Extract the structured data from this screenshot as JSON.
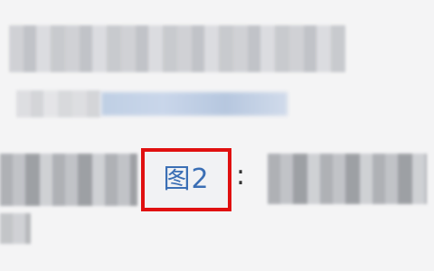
{
  "figure": {
    "label": "图2",
    "separator": ":"
  },
  "colors": {
    "highlight_border": "#e01010",
    "label_text": "#3b6fb5",
    "background": "#f4f4f5"
  }
}
